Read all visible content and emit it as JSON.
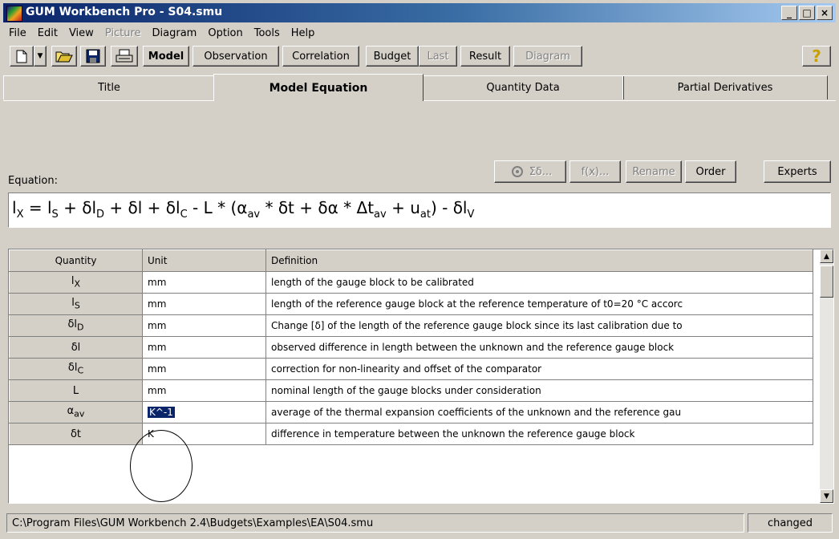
{
  "window": {
    "title": "GUM Workbench Pro - S04.smu"
  },
  "menu": {
    "items": [
      "File",
      "Edit",
      "View",
      "Picture",
      "Diagram",
      "Option",
      "Tools",
      "Help"
    ]
  },
  "toolbar": {
    "model": "Model",
    "observation": "Observation",
    "correlation": "Correlation",
    "budget": "Budget",
    "last": "Last",
    "result": "Result",
    "diagram": "Diagram",
    "help": "?"
  },
  "tabs": [
    "Title",
    "Model Equation",
    "Quantity Data",
    "Partial Derivatives"
  ],
  "equation_section": {
    "label": "Equation:",
    "buttons": {
      "sigma": "Σδ...",
      "fx": "f(x)...",
      "rename": "Rename",
      "order": "Order",
      "experts": "Experts"
    }
  },
  "grid": {
    "headers": [
      "Quantity",
      "Unit",
      "Definition"
    ],
    "rows": [
      {
        "unit": "mm",
        "definition": "length of the gauge block to be calibrated"
      },
      {
        "unit": "mm",
        "definition": "length of the reference gauge block at the reference temperature of t0=20 °C accorc"
      },
      {
        "unit": "mm",
        "definition": "Change [δ] of the length of the reference gauge block since its last calibration due to"
      },
      {
        "unit": "mm",
        "definition": "observed difference in length between the unknown and the reference gauge block"
      },
      {
        "unit": "mm",
        "definition": "correction for non-linearity and offset of the comparator"
      },
      {
        "unit": "mm",
        "definition": "nominal length of the gauge blocks under consideration"
      },
      {
        "unit": "K^-1",
        "definition": "average of the thermal expansion coefficients of the unknown and the reference gau"
      },
      {
        "unit": "K",
        "definition": "difference in temperature between the unknown the reference gauge block"
      }
    ]
  },
  "status": {
    "path": "C:\\Program Files\\GUM Workbench 2.4\\Budgets\\Examples\\EA\\S04.smu",
    "state": "changed"
  }
}
